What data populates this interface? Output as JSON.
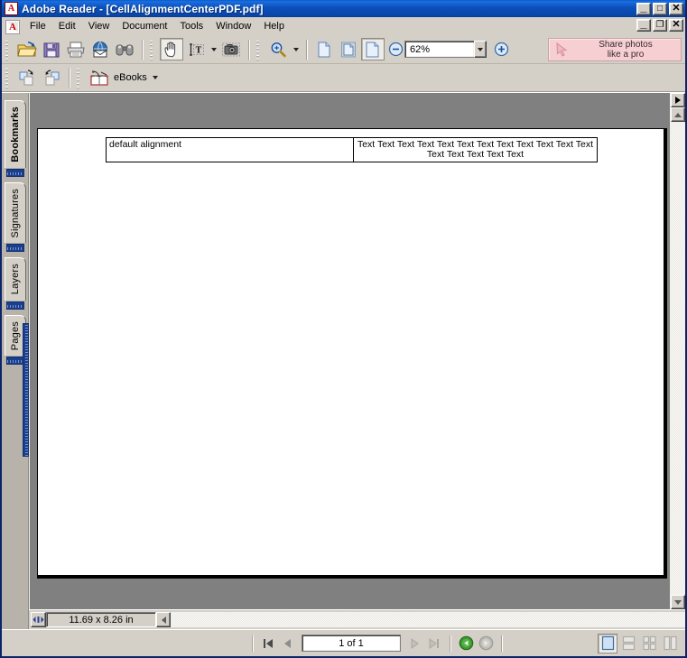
{
  "window": {
    "title": "Adobe Reader - [CellAlignmentCenterPDF.pdf]",
    "app_icon": "adobe-reader-icon",
    "minimize_label": "_",
    "maximize_label": "□",
    "close_label": "✕",
    "mdi_minimize_label": "_",
    "mdi_restore_label": "❐",
    "mdi_close_label": "✕"
  },
  "menu": {
    "icon": "adobe-document-icon",
    "items": [
      {
        "label": "File"
      },
      {
        "label": "Edit"
      },
      {
        "label": "View"
      },
      {
        "label": "Document"
      },
      {
        "label": "Tools"
      },
      {
        "label": "Window"
      },
      {
        "label": "Help"
      }
    ]
  },
  "toolbar": {
    "file_group": [
      {
        "name": "open-icon",
        "tooltip": "Open"
      },
      {
        "name": "save-icon",
        "tooltip": "Save a Copy"
      },
      {
        "name": "print-icon",
        "tooltip": "Print"
      },
      {
        "name": "email-icon",
        "tooltip": "Email"
      },
      {
        "name": "search-icon",
        "tooltip": "Search"
      }
    ],
    "tools_group": [
      {
        "name": "hand-tool-icon",
        "tooltip": "Hand Tool",
        "pressed": true
      },
      {
        "name": "text-select-icon",
        "tooltip": "Select Text"
      },
      {
        "name": "snapshot-icon",
        "tooltip": "Snapshot Tool"
      }
    ],
    "zoom_group": [
      {
        "name": "zoom-in-tool-icon",
        "tooltip": "Zoom In Tool"
      }
    ],
    "page_fit_group": [
      {
        "name": "actual-size-icon",
        "tooltip": "Actual Size"
      },
      {
        "name": "fit-page-icon",
        "tooltip": "Fit Page"
      },
      {
        "name": "fit-width-icon",
        "tooltip": "Fit Width",
        "pressed": true
      }
    ],
    "zoom_out_icon": "zoom-out-icon",
    "zoom_in_icon": "zoom-in-icon",
    "zoom_value": "62%",
    "zoom_dropdown_icon": "chevron-down-icon"
  },
  "toolbar2": {
    "rotate_cw_icon": "rotate-clockwise-icon",
    "rotate_ccw_icon": "rotate-counterclockwise-icon",
    "ebooks_icon": "ebooks-book-icon",
    "ebooks_label": "eBooks",
    "ebooks_dropdown_icon": "chevron-down-icon"
  },
  "ad": {
    "icon": "cursor-arrow-icon",
    "line1": "Share photos",
    "line2": "like a pro",
    "background": "#f6cfd3"
  },
  "sidebar": {
    "tabs": [
      {
        "label": "Bookmarks",
        "active": true
      },
      {
        "label": "Signatures",
        "active": false
      },
      {
        "label": "Layers",
        "active": false
      },
      {
        "label": "Pages",
        "active": false
      }
    ]
  },
  "document": {
    "table": {
      "rows": [
        {
          "cells": [
            {
              "text": "default alignment",
              "align": "left"
            },
            {
              "text": "Text Text Text Text Text Text Text Text Text Text Text Text Text Text Text Text Text",
              "align": "center"
            }
          ]
        }
      ]
    }
  },
  "statusbar": {
    "size_grip_icon": "resize-grip-icon",
    "page_size": "11.69 x 8.26 in",
    "hscroll_left_icon": "scroll-left-icon"
  },
  "vscroll": {
    "expand_icon": "panel-expand-right-icon",
    "up_icon": "scroll-up-icon",
    "down_icon": "scroll-down-icon"
  },
  "navbar": {
    "first_page_icon": "first-page-icon",
    "prev_page_icon": "previous-page-icon",
    "page_indicator": "1 of 1",
    "next_page_icon": "next-page-icon",
    "last_page_icon": "last-page-icon",
    "back_icon": "previous-view-icon",
    "forward_icon": "next-view-icon",
    "view_modes": [
      {
        "name": "single-page-view-button",
        "active": true
      },
      {
        "name": "continuous-view-button",
        "active": false
      },
      {
        "name": "continuous-facing-view-button",
        "active": false
      },
      {
        "name": "facing-view-button",
        "active": false
      }
    ]
  }
}
